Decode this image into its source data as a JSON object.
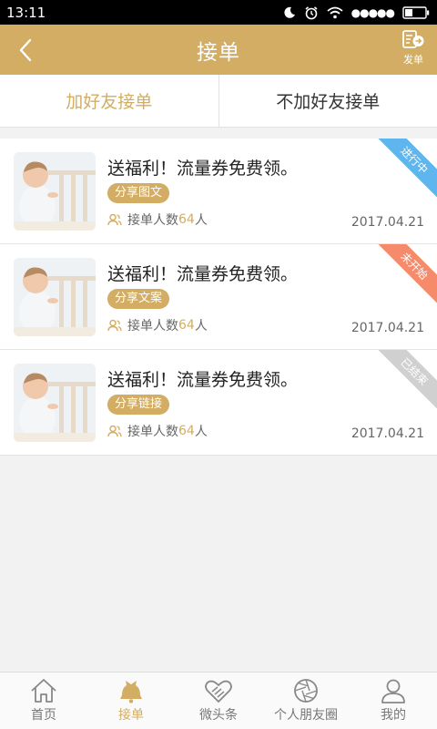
{
  "status_bar": {
    "time": "13:11"
  },
  "header": {
    "title": "接单",
    "dispatch_label": "发单"
  },
  "segments": [
    {
      "label": "加好友接单",
      "active": true
    },
    {
      "label": "不加好友接单",
      "active": false
    }
  ],
  "orders": [
    {
      "title": "送福利！流量券免费领。",
      "tag": "分享图文",
      "stat_prefix": "接单人数",
      "count": "64",
      "stat_suffix": "人",
      "date": "2017.04.21",
      "status": "进行中",
      "status_color": "#5fb6ef"
    },
    {
      "title": "送福利！流量券免费领。",
      "tag": "分享文案",
      "stat_prefix": "接单人数",
      "count": "64",
      "stat_suffix": "人",
      "date": "2017.04.21",
      "status": "未开始",
      "status_color": "#f58b6a"
    },
    {
      "title": "送福利！流量券免费领。",
      "tag": "分享链接",
      "stat_prefix": "接单人数",
      "count": "64",
      "stat_suffix": "人",
      "date": "2017.04.21",
      "status": "已结束",
      "status_color": "#d0d0d0"
    }
  ],
  "tabbar": [
    {
      "label": "首页",
      "icon": "home-icon",
      "active": false
    },
    {
      "label": "接单",
      "icon": "bell-icon",
      "active": true
    },
    {
      "label": "微头条",
      "icon": "heart-hands-icon",
      "active": false
    },
    {
      "label": "个人朋友圈",
      "icon": "aperture-icon",
      "active": false
    },
    {
      "label": "我的",
      "icon": "user-icon",
      "active": false
    }
  ],
  "colors": {
    "brand": "#d2ad63",
    "text": "#333333",
    "background": "#f2f2f2"
  }
}
